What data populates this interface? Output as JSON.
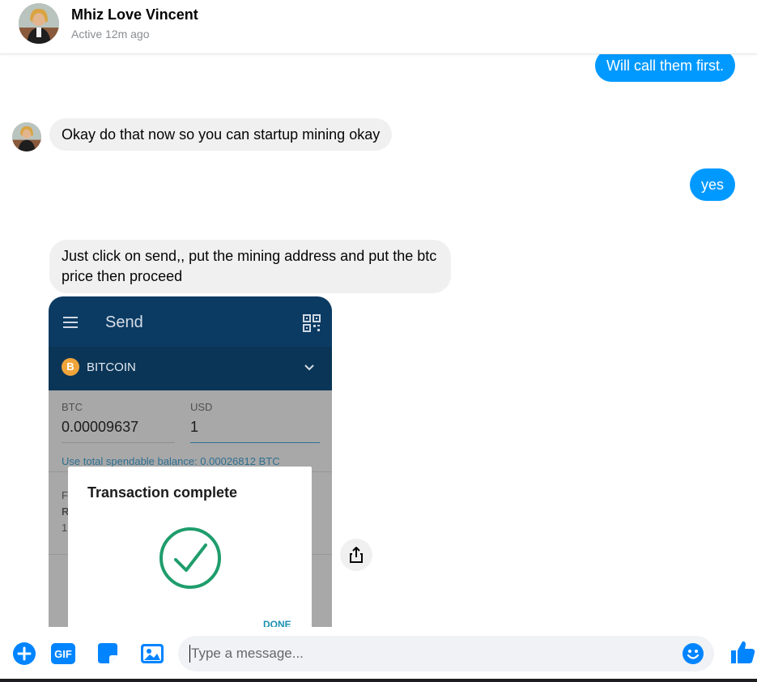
{
  "header": {
    "name": "Mhiz Love Vincent",
    "status": "Active 12m ago"
  },
  "messages": [
    {
      "from": "me",
      "text": "Will call them first."
    },
    {
      "from": "them",
      "text": "Okay do that now so you can startup mining okay"
    },
    {
      "from": "me",
      "text": "yes"
    },
    {
      "from": "them",
      "text": "Just click on send,, put the mining address and put the btc price then proceed"
    }
  ],
  "screenshot": {
    "title": "Send",
    "coin": "BITCOIN",
    "coin_symbol": "B",
    "btc_label": "BTC",
    "btc_value": "0.00009637",
    "usd_label": "USD",
    "usd_value": "1",
    "spendable": "Use total spendable balance: 0.00026812 BTC",
    "frag1": "F",
    "frag2": "R",
    "frag3": "1",
    "modal_title": "Transaction complete",
    "done": "DONE"
  },
  "composer": {
    "placeholder": "Type a message...",
    "gif_label": "GIF"
  },
  "colors": {
    "outgoing": "#0099ff",
    "incoming": "#f0f0f0",
    "accent": "#0084ff"
  }
}
